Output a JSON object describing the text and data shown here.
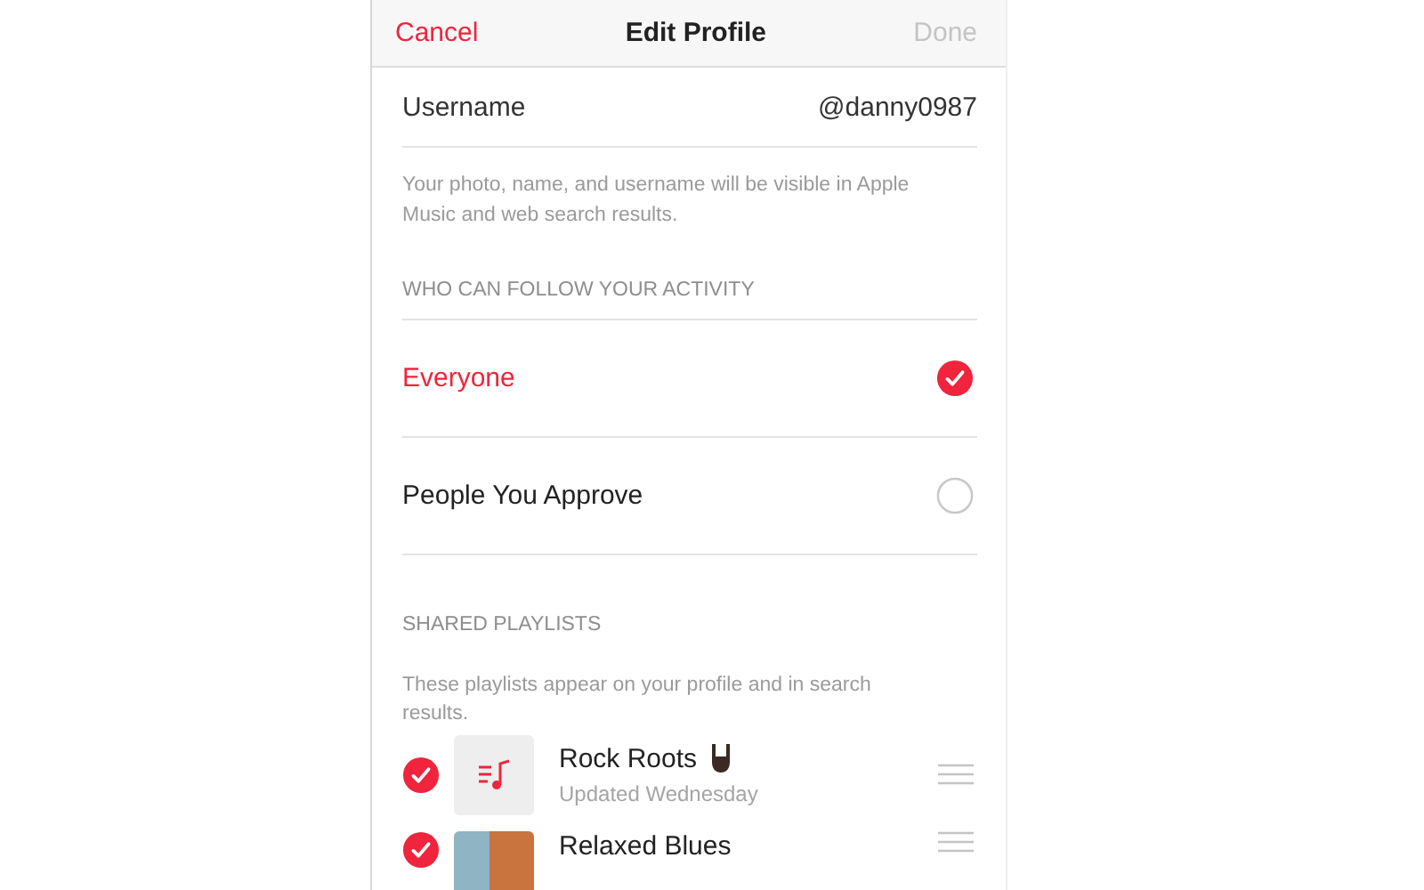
{
  "nav": {
    "cancel": "Cancel",
    "title": "Edit Profile",
    "done": "Done",
    "done_disabled": true
  },
  "username": {
    "label": "Username",
    "value": "@danny0987"
  },
  "username_note": "Your photo, name, and username will be visible in Apple Music and web search results.",
  "follow_header": "WHO CAN FOLLOW YOUR ACTIVITY",
  "follow_options": [
    {
      "label": "Everyone",
      "selected": true
    },
    {
      "label": "People You Approve",
      "selected": false
    }
  ],
  "playlists_header": "SHARED PLAYLISTS",
  "playlists_note": "These playlists appear on your profile and in search results.",
  "playlists": [
    {
      "title": "Rock Roots",
      "subtitle": "Updated Wednesday",
      "checked": true,
      "kind": "note"
    },
    {
      "title": "Relaxed Blues",
      "checked": true,
      "kind": "photo"
    }
  ]
}
